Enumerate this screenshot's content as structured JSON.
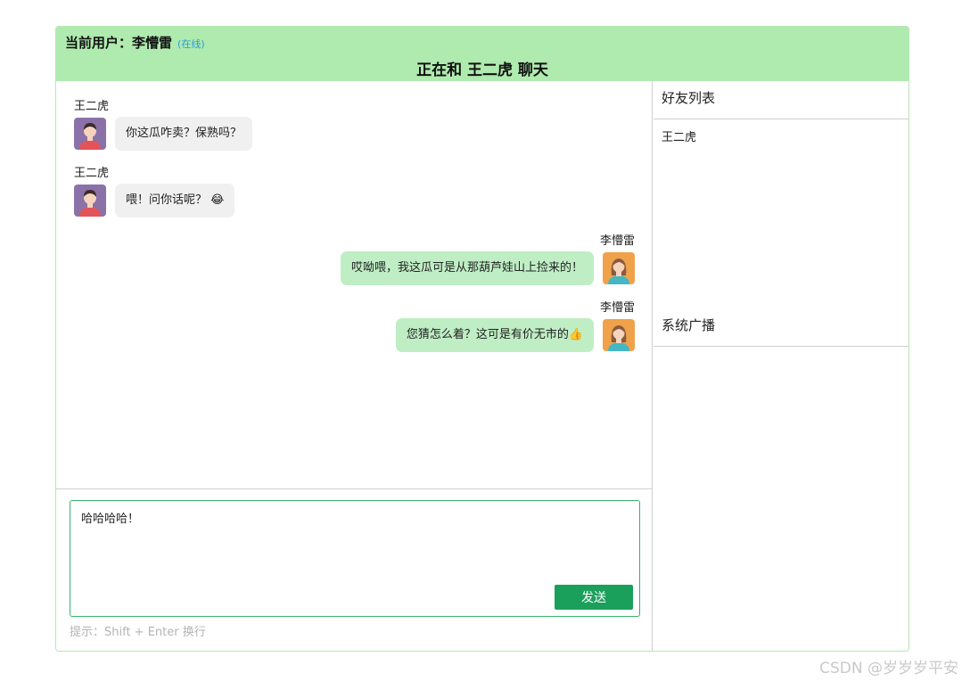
{
  "header": {
    "current_user_label": "当前用户：",
    "current_user_name": "李懵雷",
    "online_status": "(在线)",
    "chat_title": "正在和 王二虎 聊天"
  },
  "messages": [
    {
      "sender": "王二虎",
      "text": "你这瓜咋卖？保熟吗？",
      "side": "left"
    },
    {
      "sender": "王二虎",
      "text": "喂！问你话呢？ 😂",
      "side": "left"
    },
    {
      "sender": "李懵雷",
      "text": "哎呦喂，我这瓜可是从那葫芦娃山上捡来的！",
      "side": "right"
    },
    {
      "sender": "李懵雷",
      "text": "您猜怎么着？这可是有价无市的👍",
      "side": "right"
    }
  ],
  "input": {
    "value": "哈哈哈哈！",
    "send_label": "发送",
    "hint": "提示：Shift + Enter 换行"
  },
  "sidebar": {
    "friends_title": "好友列表",
    "friends": [
      "王二虎"
    ],
    "broadcast_title": "系统广播"
  },
  "watermark": "CSDN @岁岁岁平安"
}
